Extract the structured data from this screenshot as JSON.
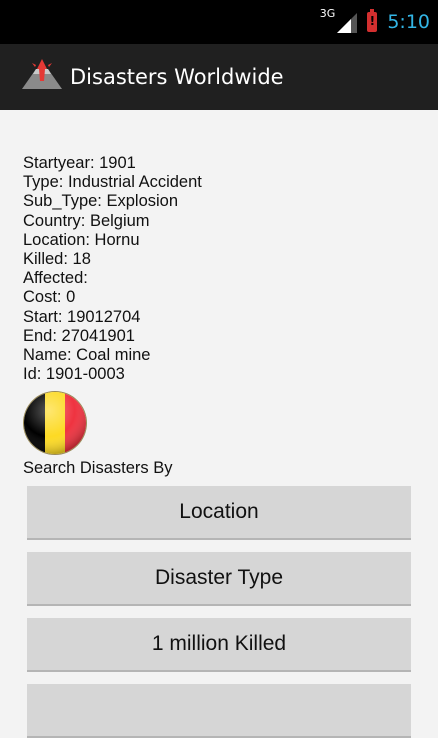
{
  "status_bar": {
    "network": "3G",
    "time": "5:10"
  },
  "action_bar": {
    "title": "Disasters Worldwide",
    "icon": "volcano-icon"
  },
  "record": {
    "lines": [
      "Startyear: 1901",
      "Type: Industrial Accident",
      "Sub_Type: Explosion",
      "Country: Belgium",
      "Location: Hornu",
      "Killed: 18",
      "Affected:",
      "Cost: 0",
      "Start: 19012704",
      "End: 27041901",
      "Name: Coal mine",
      "Id: 1901-0003"
    ],
    "flag": "belgium-flag-icon",
    "flag_colors": [
      "#000000",
      "#FDDA24",
      "#EF3340"
    ]
  },
  "search": {
    "heading": "Search Disasters By",
    "buttons": [
      "Location",
      "Disaster Type",
      "1 million Killed"
    ]
  },
  "colors": {
    "clock": "#33b5e5",
    "action_bar": "#202020",
    "button": "#d6d6d6"
  }
}
